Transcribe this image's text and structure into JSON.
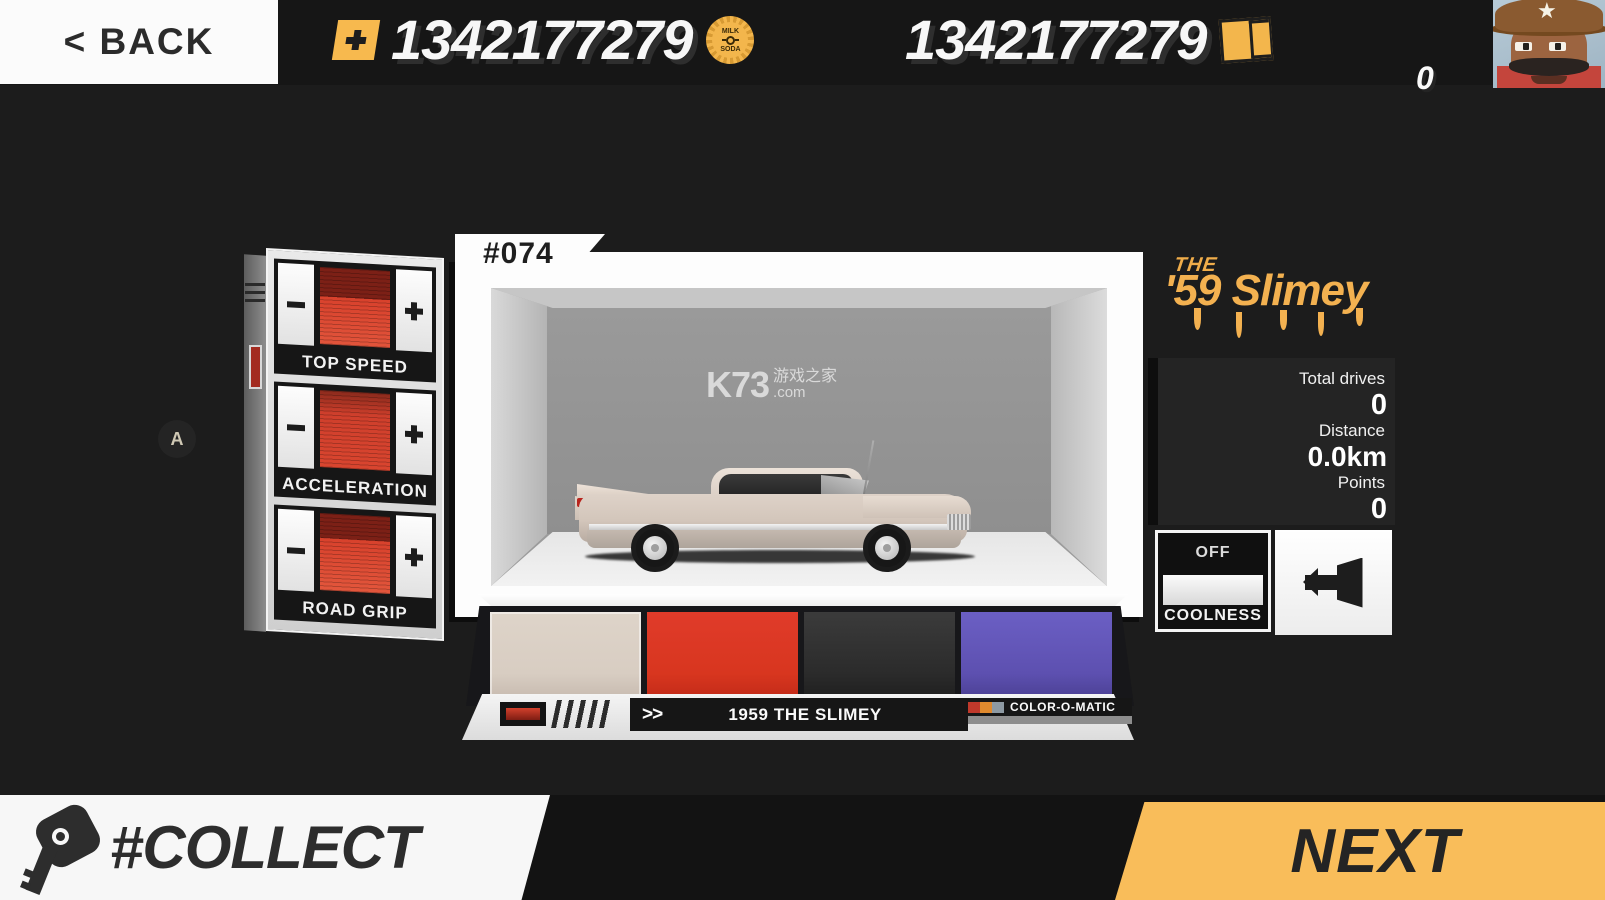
{
  "header": {
    "back_label": "< BACK",
    "currency_primary": {
      "value": "1342177279",
      "icon": "bottlecap-icon",
      "cap_text_top": "MILK",
      "cap_text_bottom": "SODA"
    },
    "currency_secondary": {
      "value": "1342177279",
      "icon": "wallet-icon"
    },
    "add_icon": "plus-icon",
    "avatar": {
      "name": "avatar",
      "level": "0"
    }
  },
  "upgrades": {
    "hint_button": "A",
    "decrease_symbol": "−",
    "increase_symbol": "+",
    "stats": [
      {
        "label": "TOP SPEED",
        "fill_percent": 62
      },
      {
        "label": "ACCELERATION",
        "fill_percent": 70
      },
      {
        "label": "ROAD GRIP",
        "fill_percent": 68
      }
    ]
  },
  "car_display": {
    "number_badge": "#074",
    "watermark": {
      "brand": "K73",
      "cn": "游戏之家",
      "domain": ".com"
    }
  },
  "color_picker": {
    "prev_label": ">>",
    "car_name": "1959 THE SLIMEY",
    "brand_label": "COLOR-O-MATIC",
    "brand_stripe_colors": [
      "#c0392b",
      "#e08a2e",
      "#8e9aa3"
    ],
    "swatches": [
      {
        "name": "cream",
        "top": "#ded4c9",
        "mid": "#d8cdc2",
        "bottom": "#c6b9ae",
        "selected": true
      },
      {
        "name": "red",
        "top": "#e03b2a",
        "mid": "#d8361f",
        "bottom": "#c12a18",
        "selected": false
      },
      {
        "name": "black",
        "top": "#3b3b3b",
        "mid": "#2b2b2b",
        "bottom": "#1e1e1e",
        "selected": false
      },
      {
        "name": "purple",
        "top": "#6b5fc4",
        "mid": "#5d50b0",
        "bottom": "#4a3f92",
        "selected": false
      }
    ]
  },
  "car_info": {
    "logo_the": "THE",
    "logo_main": "'59 Slimey",
    "logo_color": "#f3b150",
    "stats": [
      {
        "label": "Total drives",
        "value": "0"
      },
      {
        "label": "Distance",
        "value": "0.0km"
      },
      {
        "label": "Points",
        "value": "0"
      }
    ],
    "coolness": {
      "state": "OFF",
      "label": "COOLNESS"
    },
    "exit_icon": "exit-door-icon"
  },
  "footer": {
    "collect_label": "#COLLECT",
    "collect_icon": "car-key-icon",
    "next_label": "NEXT",
    "next_color": "#f9bd5a"
  }
}
